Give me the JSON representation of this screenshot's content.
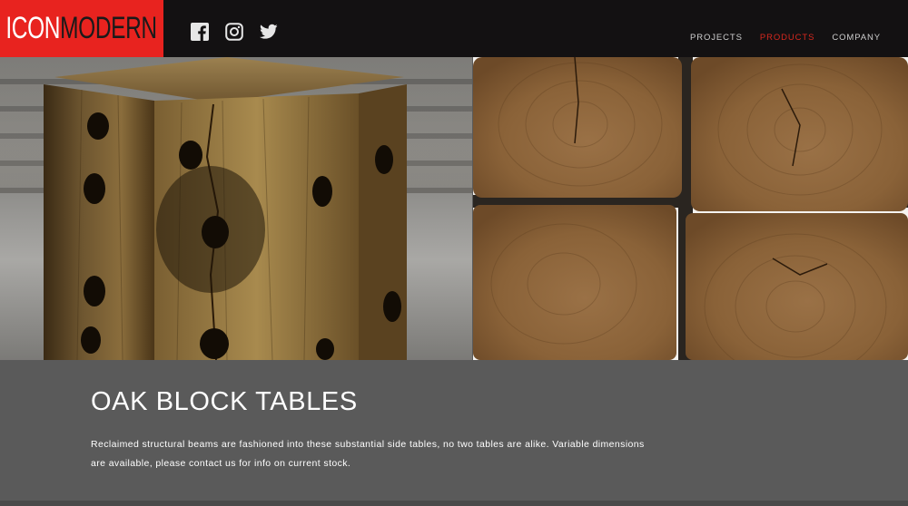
{
  "brand": {
    "logo_part1": "ICON",
    "logo_part2": "MODERN",
    "accent_color": "#e8231f"
  },
  "social": [
    {
      "icon": "facebook-icon"
    },
    {
      "icon": "instagram-icon"
    },
    {
      "icon": "twitter-icon"
    }
  ],
  "nav": {
    "items": [
      {
        "label": "PROJECTS",
        "active": false
      },
      {
        "label": "PRODUCTS",
        "active": true
      },
      {
        "label": "COMPANY",
        "active": false
      }
    ],
    "active_color": "#d6281f"
  },
  "product": {
    "title": "OAK BLOCK TABLES",
    "description": "Reclaimed structural beams are fashioned into these substantial side tables, no two tables are alike. Variable dimensions are available, please contact us for info on current stock."
  }
}
